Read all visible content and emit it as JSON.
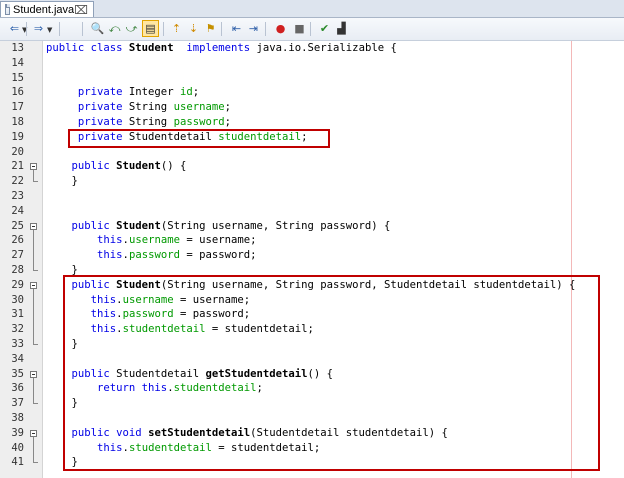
{
  "tab": {
    "label": "Student.java",
    "close": "⌧"
  },
  "toolbar": {
    "buttons": [
      {
        "name": "back-icon",
        "glyph": "⇐"
      },
      {
        "name": "forward-icon",
        "glyph": "⇒"
      },
      {
        "name": "find-icon",
        "glyph": "🔍"
      },
      {
        "name": "find-previous-icon",
        "glyph": "⤺"
      },
      {
        "name": "find-next-icon",
        "glyph": "⤻"
      },
      {
        "name": "toggle-highlight-icon",
        "glyph": "▤"
      },
      {
        "name": "previous-bookmark-icon",
        "glyph": "⇡"
      },
      {
        "name": "next-bookmark-icon",
        "glyph": "⇣"
      },
      {
        "name": "toggle-bookmark-icon",
        "glyph": "⚑"
      },
      {
        "name": "shift-left-icon",
        "glyph": "⇤"
      },
      {
        "name": "shift-right-icon",
        "glyph": "⇥"
      },
      {
        "name": "start-macro-icon",
        "glyph": "●"
      },
      {
        "name": "stop-macro-icon",
        "glyph": "■"
      },
      {
        "name": "check-icon",
        "glyph": "✔"
      },
      {
        "name": "diff-icon",
        "glyph": "▟"
      }
    ]
  },
  "lines": [
    {
      "n": "13",
      "tokens": [
        [
          "kw",
          "public class "
        ],
        [
          "mn",
          "Student"
        ],
        [
          "tp",
          "  "
        ],
        [
          "kw",
          "implements "
        ],
        [
          "tp",
          "java.io.Serializable {"
        ]
      ]
    },
    {
      "n": "14",
      "tokens": []
    },
    {
      "n": "15",
      "tokens": []
    },
    {
      "n": "16",
      "tokens": [
        [
          "tp",
          "     "
        ],
        [
          "kw",
          "private "
        ],
        [
          "tp",
          "Integer "
        ],
        [
          "fd",
          "id"
        ],
        [
          "tp",
          ";"
        ]
      ]
    },
    {
      "n": "17",
      "tokens": [
        [
          "tp",
          "     "
        ],
        [
          "kw",
          "private "
        ],
        [
          "tp",
          "String "
        ],
        [
          "fd",
          "username"
        ],
        [
          "tp",
          ";"
        ]
      ]
    },
    {
      "n": "18",
      "tokens": [
        [
          "tp",
          "     "
        ],
        [
          "kw",
          "private "
        ],
        [
          "tp",
          "String "
        ],
        [
          "fd",
          "password"
        ],
        [
          "tp",
          ";"
        ]
      ]
    },
    {
      "n": "19",
      "tokens": [
        [
          "tp",
          "     "
        ],
        [
          "kw",
          "private "
        ],
        [
          "tp",
          "Studentdetail "
        ],
        [
          "fd",
          "studentdetail"
        ],
        [
          "tp",
          ";"
        ]
      ]
    },
    {
      "n": "20",
      "tokens": []
    },
    {
      "n": "21",
      "tokens": [
        [
          "tp",
          "    "
        ],
        [
          "kw",
          "public "
        ],
        [
          "mn",
          "Student"
        ],
        [
          "tp",
          "() {"
        ]
      ]
    },
    {
      "n": "22",
      "tokens": [
        [
          "tp",
          "    }"
        ]
      ]
    },
    {
      "n": "23",
      "tokens": []
    },
    {
      "n": "24",
      "tokens": []
    },
    {
      "n": "25",
      "tokens": [
        [
          "tp",
          "    "
        ],
        [
          "kw",
          "public "
        ],
        [
          "mn",
          "Student"
        ],
        [
          "tp",
          "(String username, String password) {"
        ]
      ]
    },
    {
      "n": "26",
      "tokens": [
        [
          "tp",
          "        "
        ],
        [
          "kw",
          "this"
        ],
        [
          "tp",
          "."
        ],
        [
          "fd",
          "username"
        ],
        [
          "tp",
          " = username;"
        ]
      ]
    },
    {
      "n": "27",
      "tokens": [
        [
          "tp",
          "        "
        ],
        [
          "kw",
          "this"
        ],
        [
          "tp",
          "."
        ],
        [
          "fd",
          "password"
        ],
        [
          "tp",
          " = password;"
        ]
      ]
    },
    {
      "n": "28",
      "tokens": [
        [
          "tp",
          "    }"
        ]
      ]
    },
    {
      "n": "29",
      "tokens": [
        [
          "tp",
          "    "
        ],
        [
          "kw",
          "public "
        ],
        [
          "mn",
          "Student"
        ],
        [
          "tp",
          "(String username, String password, Studentdetail studentdetail) {"
        ]
      ]
    },
    {
      "n": "30",
      "tokens": [
        [
          "tp",
          "       "
        ],
        [
          "kw",
          "this"
        ],
        [
          "tp",
          "."
        ],
        [
          "fd",
          "username"
        ],
        [
          "tp",
          " = username;"
        ]
      ]
    },
    {
      "n": "31",
      "tokens": [
        [
          "tp",
          "       "
        ],
        [
          "kw",
          "this"
        ],
        [
          "tp",
          "."
        ],
        [
          "fd",
          "password"
        ],
        [
          "tp",
          " = password;"
        ]
      ]
    },
    {
      "n": "32",
      "tokens": [
        [
          "tp",
          "       "
        ],
        [
          "kw",
          "this"
        ],
        [
          "tp",
          "."
        ],
        [
          "fd",
          "studentdetail"
        ],
        [
          "tp",
          " = studentdetail;"
        ]
      ]
    },
    {
      "n": "33",
      "tokens": [
        [
          "tp",
          "    }"
        ]
      ]
    },
    {
      "n": "34",
      "tokens": []
    },
    {
      "n": "35",
      "tokens": [
        [
          "tp",
          "    "
        ],
        [
          "kw",
          "public "
        ],
        [
          "tp",
          "Studentdetail "
        ],
        [
          "mn",
          "getStudentdetail"
        ],
        [
          "tp",
          "() {"
        ]
      ]
    },
    {
      "n": "36",
      "tokens": [
        [
          "tp",
          "        "
        ],
        [
          "kw",
          "return this"
        ],
        [
          "tp",
          "."
        ],
        [
          "fd",
          "studentdetail"
        ],
        [
          "tp",
          ";"
        ]
      ]
    },
    {
      "n": "37",
      "tokens": [
        [
          "tp",
          "    }"
        ]
      ]
    },
    {
      "n": "38",
      "tokens": []
    },
    {
      "n": "39",
      "tokens": [
        [
          "tp",
          "    "
        ],
        [
          "kw",
          "public void "
        ],
        [
          "mn",
          "setStudentdetail"
        ],
        [
          "tp",
          "(Studentdetail studentdetail) {"
        ]
      ]
    },
    {
      "n": "40",
      "tokens": [
        [
          "tp",
          "        "
        ],
        [
          "kw",
          "this"
        ],
        [
          "tp",
          "."
        ],
        [
          "fd",
          "studentdetail"
        ],
        [
          "tp",
          " = studentdetail;"
        ]
      ]
    },
    {
      "n": "41",
      "tokens": [
        [
          "tp",
          "    }"
        ]
      ]
    }
  ],
  "highlight_color": "#c00000"
}
